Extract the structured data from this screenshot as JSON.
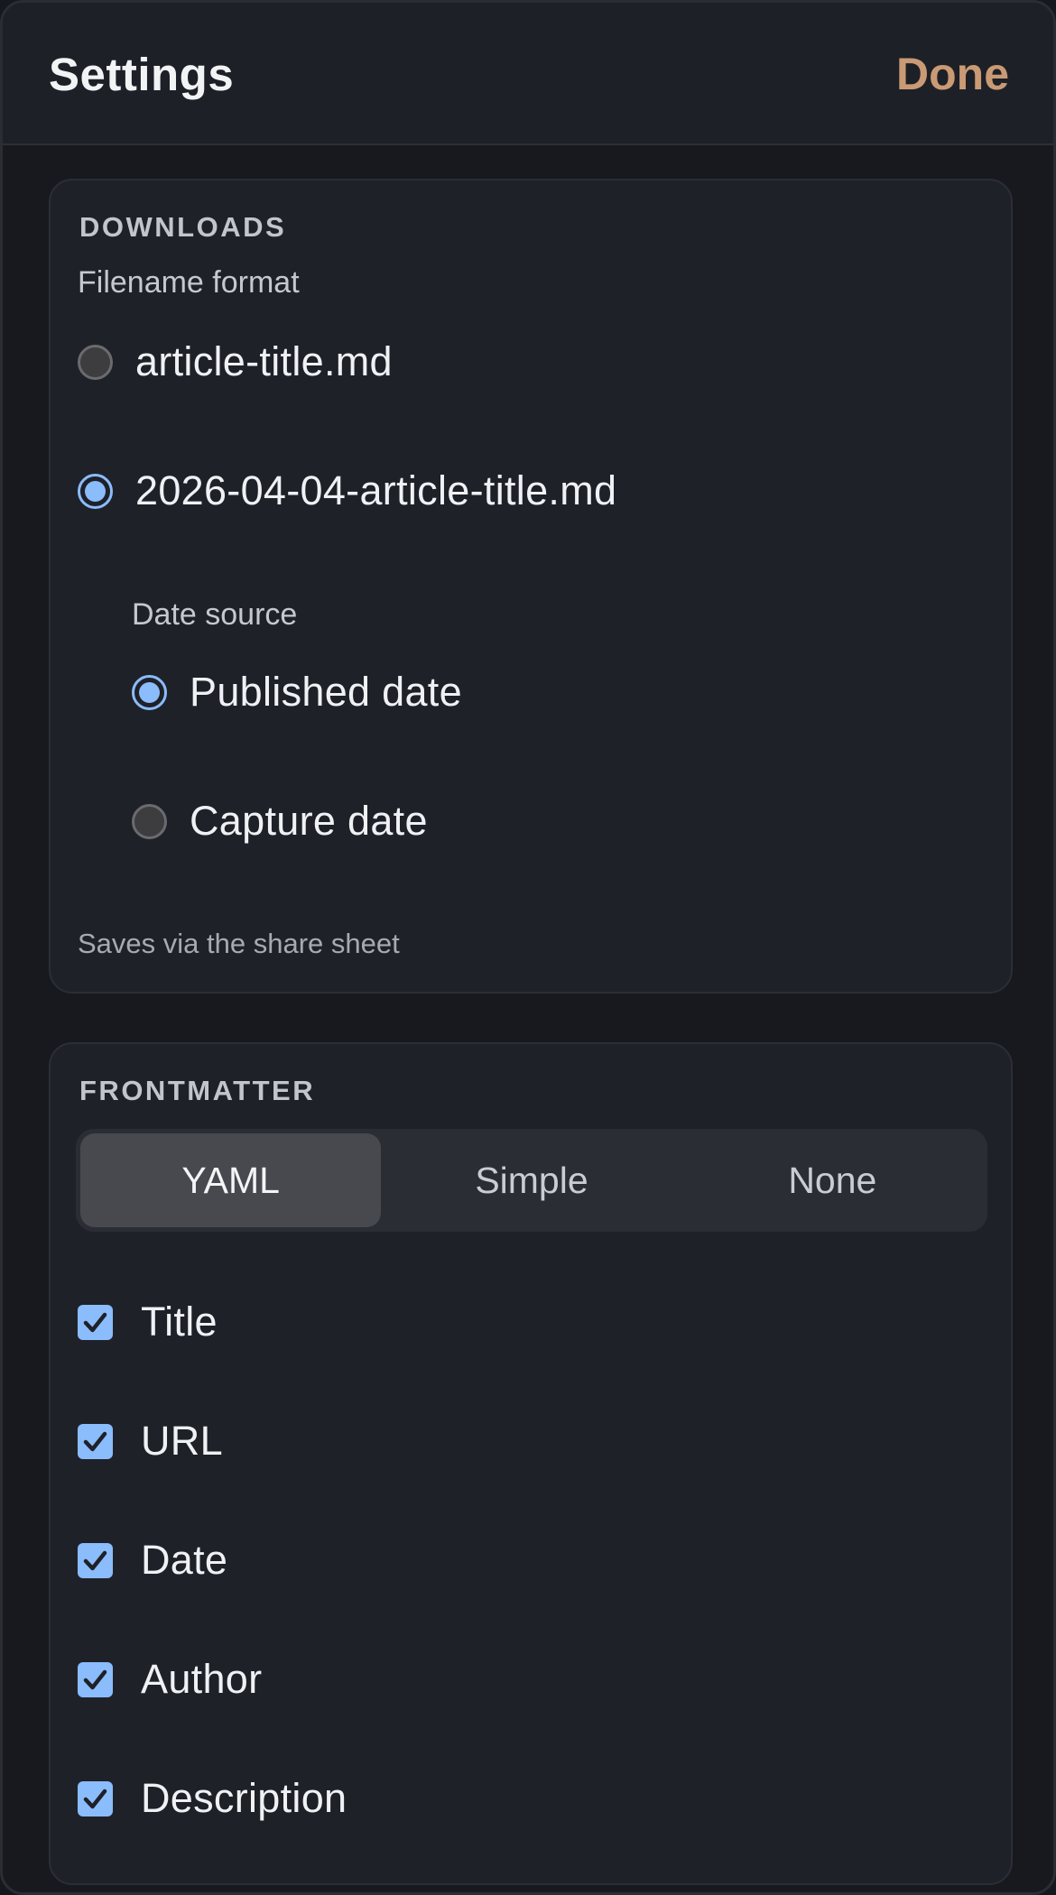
{
  "header": {
    "title": "Settings",
    "done_label": "Done"
  },
  "downloads": {
    "section_title": "DOWNLOADS",
    "filename_format_label": "Filename format",
    "filename_options": [
      {
        "label": "article-title.md",
        "selected": false
      },
      {
        "label": "2026-04-04-article-title.md",
        "selected": true
      }
    ],
    "date_source_label": "Date source",
    "date_source_options": [
      {
        "label": "Published date",
        "selected": true
      },
      {
        "label": "Capture date",
        "selected": false
      }
    ],
    "footnote": "Saves via the share sheet"
  },
  "frontmatter": {
    "section_title": "FRONTMATTER",
    "format_tabs": [
      {
        "label": "YAML",
        "active": true
      },
      {
        "label": "Simple",
        "active": false
      },
      {
        "label": "None",
        "active": false
      }
    ],
    "fields": [
      {
        "label": "Title",
        "checked": true
      },
      {
        "label": "URL",
        "checked": true
      },
      {
        "label": "Date",
        "checked": true
      },
      {
        "label": "Author",
        "checked": true
      },
      {
        "label": "Description",
        "checked": true
      }
    ]
  },
  "colors": {
    "accent": "#8bbcfb",
    "done": "#c99a74",
    "background": "#17191e",
    "card": "#1f2129"
  }
}
